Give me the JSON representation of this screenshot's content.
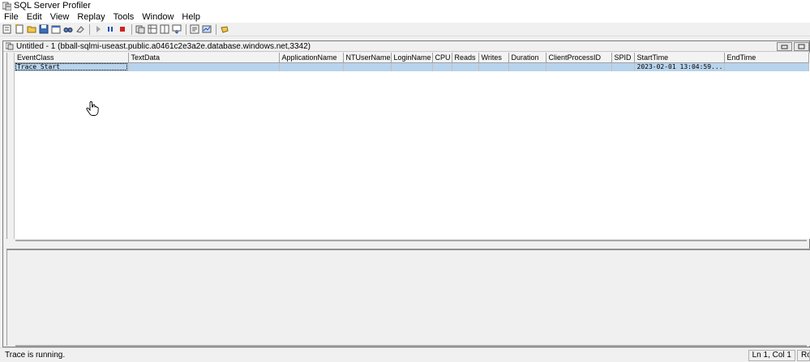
{
  "window": {
    "title": "SQL Server Profiler"
  },
  "menu": [
    "File",
    "Edit",
    "View",
    "Replay",
    "Tools",
    "Window",
    "Help"
  ],
  "toolbar": {
    "icons": [
      "new-trace-icon",
      "new-template-icon",
      "open-icon",
      "save-icon",
      "properties-icon",
      "find-icon",
      "clear-icon",
      "run-icon",
      "pause-icon",
      "stop-icon",
      "events-icon",
      "columns-icon",
      "filters-icon",
      "autoscroll-icon",
      "template-props-icon",
      "dashboard-icon",
      "help-icon"
    ],
    "accent_stop": "#d12020",
    "accent_pause": "#1f4fb8"
  },
  "document": {
    "title": "Untitled - 1 (bball-sqlmi-useast.public.a0461c2e3a2e.database.windows.net,3342)"
  },
  "grid": {
    "columns": [
      "EventClass",
      "TextData",
      "ApplicationName",
      "NTUserName",
      "LoginName",
      "CPU",
      "Reads",
      "Writes",
      "Duration",
      "ClientProcessID",
      "SPID",
      "StartTime",
      "EndTime"
    ],
    "rows": [
      [
        "Trace Start",
        "",
        "",
        "",
        "",
        "",
        "",
        "",
        "",
        "",
        "",
        "2023-02-01 13:04:59...",
        ""
      ]
    ],
    "selection_color": "#b8d3ec"
  },
  "status": {
    "text": "Trace is running.",
    "position": "Ln 1, Col 1",
    "rows": "Rows"
  }
}
